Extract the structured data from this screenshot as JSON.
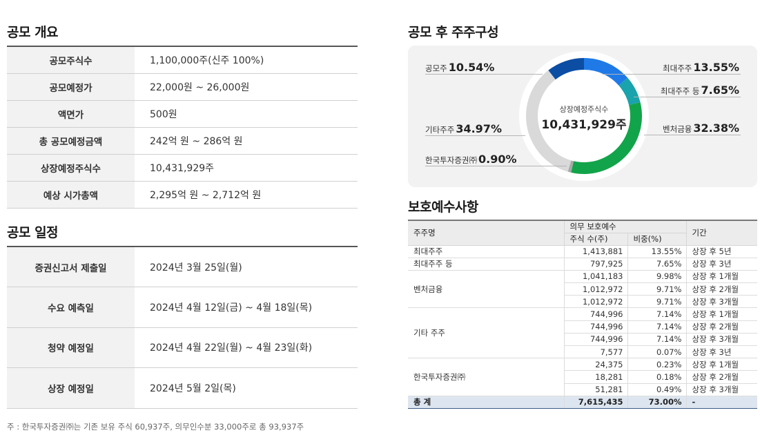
{
  "overview": {
    "title": "공모 개요",
    "rows": [
      {
        "label": "공모주식수",
        "value": "1,100,000주(신주 100%)"
      },
      {
        "label": "공모예정가",
        "value": "22,000원 ~ 26,000원"
      },
      {
        "label": "액면가",
        "value": "500원"
      },
      {
        "label": "총 공모예정금액",
        "value": "242억 원 ~ 286억 원"
      },
      {
        "label": "상장예정주식수",
        "value": "10,431,929주"
      },
      {
        "label": "예상 시가총액",
        "value": "2,295억 원 ~ 2,712억 원"
      }
    ]
  },
  "schedule": {
    "title": "공모 일정",
    "rows": [
      {
        "label": "증권신고서 제출일",
        "value": "2024년 3월 25일(월)"
      },
      {
        "label": "수요 예측일",
        "value": "2024년 4월 12일(금) ~ 4월 18일(목)"
      },
      {
        "label": "청약 예정일",
        "value": "2024년 4월 22일(월) ~ 4월 23일(화)"
      },
      {
        "label": "상장 예정일",
        "value": "2024년 5월 2일(목)"
      }
    ]
  },
  "footnote": "주 : 한국투자증권㈜는 기존 보유 주식 60,937주, 의무인수분 33,000주로 총 93,937주",
  "shareholding": {
    "title": "공모 후 주주구성",
    "center_label": "상장예정주식수",
    "center_value": "10,431,929주",
    "segments": [
      {
        "label": "최대주주",
        "pct_text": "13.55%",
        "value": 13.55,
        "color": "#1f7ae8"
      },
      {
        "label": "최대주주 등",
        "pct_text": "7.65%",
        "value": 7.65,
        "color": "#19a3ac"
      },
      {
        "label": "벤처금융",
        "pct_text": "32.38%",
        "value": 32.38,
        "color": "#12a44a"
      },
      {
        "label": "한국투자증권㈜",
        "pct_text": "0.90%",
        "value": 0.9,
        "color": "#a9a9a9"
      },
      {
        "label": "기타주주",
        "pct_text": "34.97%",
        "value": 34.97,
        "color": "#d9d9d9"
      },
      {
        "label": "공모주",
        "pct_text": "10.54%",
        "value": 10.54,
        "color": "#0b4ea3"
      }
    ]
  },
  "lockup": {
    "title": "보호예수사항",
    "headers": {
      "holder": "주주명",
      "group": "의무 보호예수",
      "shares": "주식 수(주)",
      "ratio": "비중(%)",
      "period": "기간"
    },
    "groups": [
      {
        "name": "최대주주",
        "rows": [
          {
            "shares": "1,413,881",
            "ratio": "13.55%",
            "period": "상장 후 5년"
          }
        ]
      },
      {
        "name": "최대주주 등",
        "rows": [
          {
            "shares": "797,925",
            "ratio": "7.65%",
            "period": "상장 후 3년"
          }
        ]
      },
      {
        "name": "벤처금융",
        "rows": [
          {
            "shares": "1,041,183",
            "ratio": "9.98%",
            "period": "상장 후 1개월"
          },
          {
            "shares": "1,012,972",
            "ratio": "9.71%",
            "period": "상장 후 2개월"
          },
          {
            "shares": "1,012,972",
            "ratio": "9.71%",
            "period": "상장 후 3개월"
          }
        ]
      },
      {
        "name": "기타 주주",
        "rows": [
          {
            "shares": "744,996",
            "ratio": "7.14%",
            "period": "상장 후 1개월"
          },
          {
            "shares": "744,996",
            "ratio": "7.14%",
            "period": "상장 후 2개월"
          },
          {
            "shares": "744,996",
            "ratio": "7.14%",
            "period": "상장 후 3개월"
          },
          {
            "shares": "7,577",
            "ratio": "0.07%",
            "period": "상장 후 3년"
          }
        ]
      },
      {
        "name": "한국투자증권㈜",
        "rows": [
          {
            "shares": "24,375",
            "ratio": "0.23%",
            "period": "상장 후 1개월"
          },
          {
            "shares": "18,281",
            "ratio": "0.18%",
            "period": "상장 후 2개월"
          },
          {
            "shares": "51,281",
            "ratio": "0.49%",
            "period": "상장 후 3개월"
          }
        ]
      }
    ],
    "total": {
      "label": "총 계",
      "shares": "7,615,435",
      "ratio": "73.00%",
      "period": "-"
    }
  }
}
